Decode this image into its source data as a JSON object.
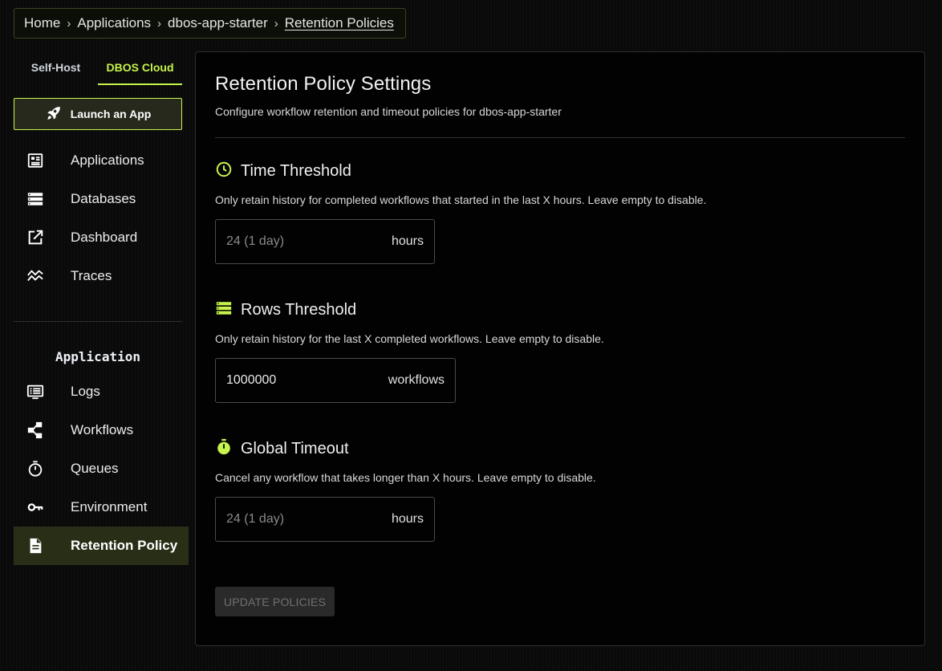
{
  "breadcrumb": {
    "items": [
      "Home",
      "Applications",
      "dbos-app-starter",
      "Retention Policies"
    ],
    "separator": "›"
  },
  "sidebar": {
    "tabs": [
      "Self-Host",
      "DBOS Cloud"
    ],
    "active_tab": "DBOS Cloud",
    "launch_label": "Launch an App",
    "nav": [
      {
        "label": "Applications",
        "icon": "applications-icon"
      },
      {
        "label": "Databases",
        "icon": "database-icon"
      },
      {
        "label": "Dashboard",
        "icon": "external-link-icon"
      },
      {
        "label": "Traces",
        "icon": "traces-icon"
      }
    ],
    "section_title": "Application",
    "app_nav": [
      {
        "label": "Logs",
        "icon": "logs-icon"
      },
      {
        "label": "Workflows",
        "icon": "workflows-icon"
      },
      {
        "label": "Queues",
        "icon": "timer-icon"
      },
      {
        "label": "Environment",
        "icon": "key-icon"
      },
      {
        "label": "Retention Policy",
        "icon": "document-icon",
        "active": true
      }
    ]
  },
  "main": {
    "title": "Retention Policy Settings",
    "subtitle": "Configure workflow retention and timeout policies for dbos-app-starter",
    "sections": [
      {
        "title": "Time Threshold",
        "icon": "clock-icon",
        "description": "Only retain history for completed workflows that started in the last X hours. Leave empty to disable.",
        "placeholder": "24 (1 day)",
        "value": "",
        "unit": "hours"
      },
      {
        "title": "Rows Threshold",
        "icon": "rows-icon",
        "description": "Only retain history for the last X completed workflows. Leave empty to disable.",
        "placeholder": "",
        "value": "1000000",
        "unit": "workflows"
      },
      {
        "title": "Global Timeout",
        "icon": "stopwatch-icon",
        "description": "Cancel any workflow that takes longer than X hours. Leave empty to disable.",
        "placeholder": "24 (1 day)",
        "value": "",
        "unit": "hours"
      }
    ],
    "update_label": "UPDATE POLICIES"
  },
  "colors": {
    "accent": "#c6f44c",
    "background": "#0a0a0a",
    "panel": "#020202",
    "active_nav": "#292f17"
  }
}
